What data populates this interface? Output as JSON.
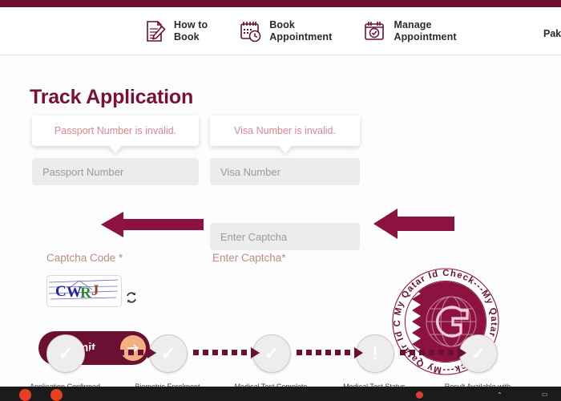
{
  "header": {
    "nav": [
      {
        "label_line1": "How to",
        "label_line2": "Book",
        "icon": "document-pencil-icon"
      },
      {
        "label_line1": "Book",
        "label_line2": "Appointment",
        "icon": "calendar-clock-icon"
      },
      {
        "label_line1": "Manage",
        "label_line2": "Appointment",
        "icon": "calendar-check-icon"
      }
    ],
    "right_partial": "Pak"
  },
  "main": {
    "title": "Track Application",
    "tooltips": {
      "passport_error": "Passport Number is invalid.",
      "visa_error": "Visa Number is invalid."
    },
    "fields": {
      "passport_placeholder": "Passport Number",
      "passport_value": "",
      "visa_placeholder": "Visa Number",
      "visa_value": "",
      "captcha_placeholder": "Enter Captcha",
      "captcha_value": ""
    },
    "labels": {
      "captcha_code": "Captcha Code *",
      "enter_captcha": "Enter Captcha*"
    },
    "captcha": {
      "text": "CWRJ",
      "chars": [
        {
          "ch": "C",
          "color": "#2222aa"
        },
        {
          "ch": "W",
          "color": "#2222aa"
        },
        {
          "ch": "R",
          "color": "#2a8a2a"
        },
        {
          "ch": "J",
          "color": "#8a4a22"
        }
      ],
      "refresh_icon": "refresh-icon"
    },
    "submit": {
      "label": "Submit",
      "arrow_icon": "arrow-right-icon"
    },
    "seal": {
      "ring_text": "My Qatar Id Check---My Qatar Id Check---My Qatar Id Check---",
      "monogram": "C",
      "color": "#8c1340"
    }
  },
  "stepper": {
    "steps": [
      {
        "state": "done",
        "glyph": "✓",
        "caption": "Application Confirmed"
      },
      {
        "state": "done",
        "glyph": "✓",
        "caption": "Biometric Enrolment"
      },
      {
        "state": "done",
        "glyph": "✓",
        "caption": "Medical Test Complete"
      },
      {
        "state": "alert",
        "glyph": "!",
        "caption": "Medical Test Status"
      },
      {
        "state": "done",
        "glyph": "✓",
        "caption": "Result Available with"
      }
    ]
  },
  "annotations": {
    "arrow_passport": "left-arrow-annotation",
    "arrow_visa": "left-arrow-annotation",
    "color": "#8c1340"
  },
  "taskbar": {
    "icons": [
      "app-icon-red",
      "app-icon-red"
    ],
    "notification_badge": "notification-badge"
  },
  "colors": {
    "brand_maroon": "#6b0f33",
    "title_maroon": "#7a1038",
    "error_pink": "#e0848e",
    "field_grey": "#ececec",
    "accent_peach": "#f3b183"
  }
}
